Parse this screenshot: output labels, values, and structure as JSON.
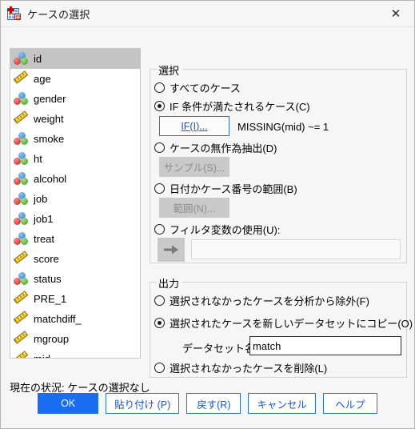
{
  "window": {
    "title": "ケースの選択",
    "icon": "spss-data-icon",
    "close_label": "✕"
  },
  "variable_list": {
    "items": [
      {
        "name": "id",
        "type": "nominal",
        "selected": true
      },
      {
        "name": "age",
        "type": "scale",
        "selected": false
      },
      {
        "name": "gender",
        "type": "nominal",
        "selected": false
      },
      {
        "name": "weight",
        "type": "scale",
        "selected": false
      },
      {
        "name": "smoke",
        "type": "nominal",
        "selected": false
      },
      {
        "name": "ht",
        "type": "nominal",
        "selected": false
      },
      {
        "name": "alcohol",
        "type": "nominal",
        "selected": false
      },
      {
        "name": "job",
        "type": "nominal",
        "selected": false
      },
      {
        "name": "job1",
        "type": "nominal",
        "selected": false
      },
      {
        "name": "treat",
        "type": "nominal",
        "selected": false
      },
      {
        "name": "score",
        "type": "scale",
        "selected": false
      },
      {
        "name": "status",
        "type": "nominal",
        "selected": false
      },
      {
        "name": "PRE_1",
        "type": "scale",
        "selected": false
      },
      {
        "name": "matchdiff_",
        "type": "scale",
        "selected": false
      },
      {
        "name": "mgroup",
        "type": "scale",
        "selected": false
      },
      {
        "name": "mid",
        "type": "scale",
        "selected": false
      }
    ]
  },
  "selection_group": {
    "legend": "選択",
    "options": {
      "all_cases": {
        "label": "すべてのケース",
        "checked": false
      },
      "if_condition": {
        "label": "IF 条件が満たされるケース(C)",
        "checked": true
      },
      "random_sample": {
        "label": "ケースの無作為抽出(D)",
        "checked": false
      },
      "range": {
        "label": "日付かケース番号の範囲(B)",
        "checked": false
      },
      "filter_variable": {
        "label": "フィルタ変数の使用(U):",
        "checked": false
      }
    },
    "if_button": {
      "label": "IF(I)...",
      "enabled": true
    },
    "if_condition_text": "MISSING(mid) ~= 1",
    "sample_button": {
      "label": "サンプル(S)...",
      "enabled": false
    },
    "range_button": {
      "label": "範囲(N)...",
      "enabled": false
    },
    "filter_field_value": "",
    "arrow_button": "arrow-right-icon"
  },
  "output_group": {
    "legend": "出力",
    "options": {
      "filter_unselected": {
        "label": "選択されなかったケースを分析から除外(F)",
        "checked": false
      },
      "copy_to_new_dataset": {
        "label": "選択されたケースを新しいデータセットにコピー(O)",
        "checked": true
      },
      "delete_unselected": {
        "label": "選択されなかったケースを削除(L)",
        "checked": false
      }
    },
    "dataset_name_label": "データセット名(S):",
    "dataset_name_value": "match",
    "dataset_name_placeholder": ""
  },
  "status": {
    "text": "現在の状況: ケースの選択なし"
  },
  "buttons": {
    "ok": "OK",
    "paste": "貼り付け (P)",
    "reset": "戻す(R)",
    "cancel": "キャンセル",
    "help": "ヘルプ"
  },
  "colors": {
    "accent": "#1a6cf0",
    "button_border": "#2f6fd0",
    "window_bg": "#f6f6f6",
    "selection_highlight": "#c4c4c4"
  }
}
